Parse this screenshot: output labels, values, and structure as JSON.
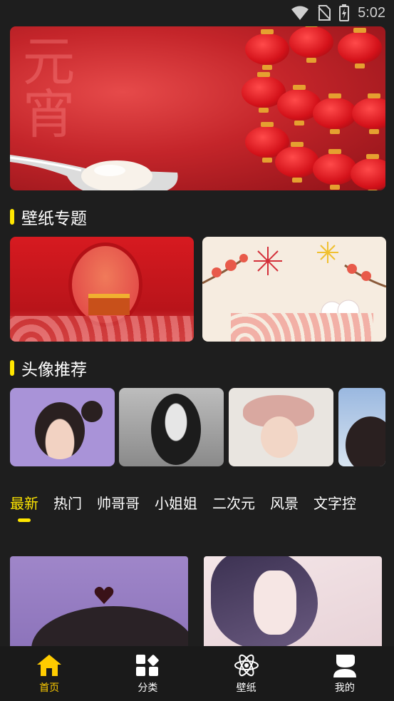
{
  "status_bar": {
    "time": "5:02"
  },
  "banner": {
    "glyph": "元宵"
  },
  "sections": {
    "topics_title": "壁纸专题",
    "avatars_title": "头像推荐"
  },
  "tabs": [
    {
      "label": "最新",
      "active": true
    },
    {
      "label": "热门",
      "active": false
    },
    {
      "label": "帅哥哥",
      "active": false
    },
    {
      "label": "小姐姐",
      "active": false
    },
    {
      "label": "二次元",
      "active": false
    },
    {
      "label": "风景",
      "active": false
    },
    {
      "label": "文字控",
      "active": false
    }
  ],
  "bottom_nav": [
    {
      "label": "首页",
      "icon": "home-icon",
      "active": true
    },
    {
      "label": "分类",
      "icon": "category-icon",
      "active": false
    },
    {
      "label": "壁纸",
      "icon": "atom-icon",
      "active": false
    },
    {
      "label": "我的",
      "icon": "profile-icon",
      "active": false
    }
  ],
  "colors": {
    "accent": "#ffe600",
    "nav_active": "#ffcc00",
    "background": "#1e1e1e"
  }
}
